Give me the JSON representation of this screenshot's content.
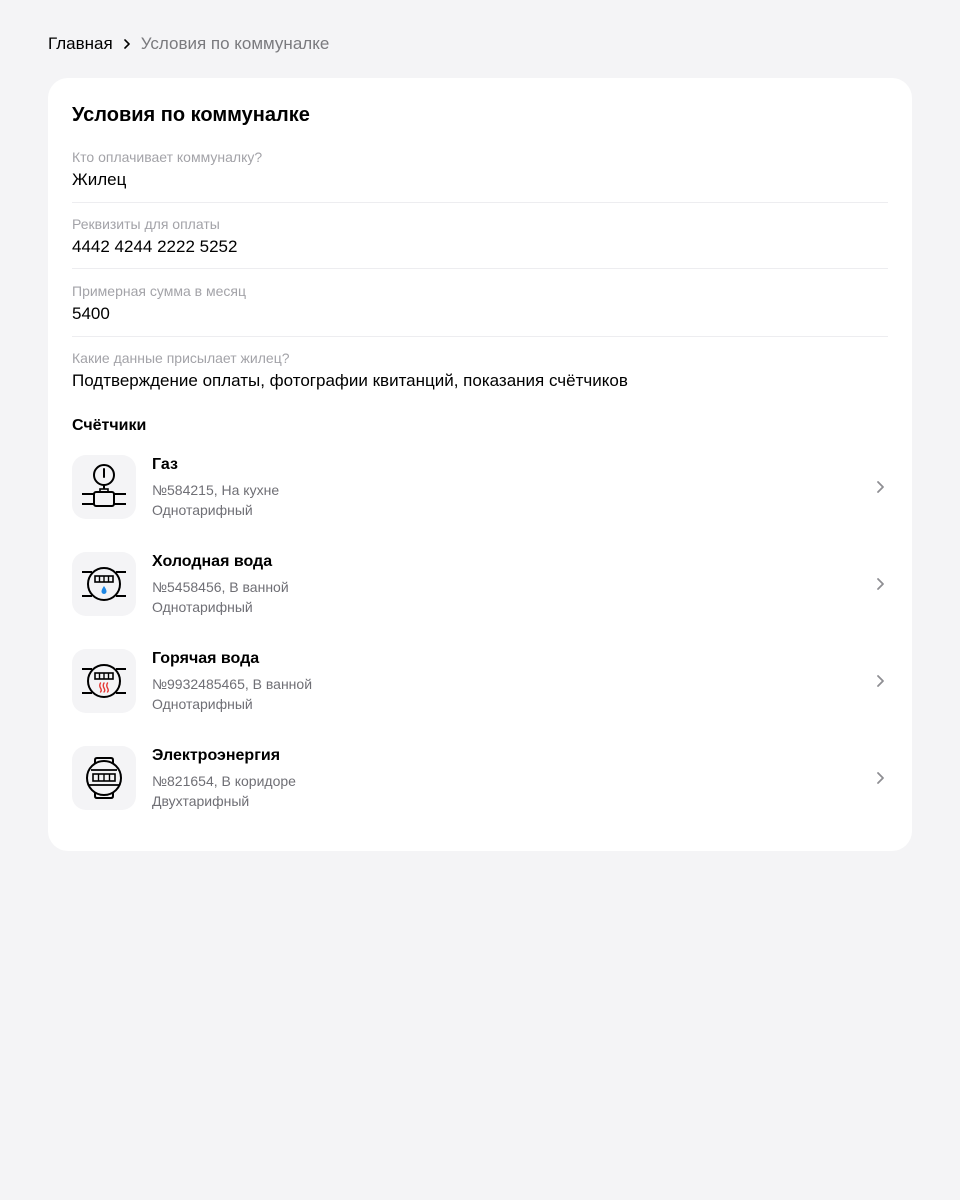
{
  "breadcrumb": {
    "home": "Главная",
    "current": "Условия по коммуналке"
  },
  "card": {
    "title": "Условия по коммуналке"
  },
  "fields": [
    {
      "label": "Кто оплачивает коммуналку?",
      "value": "Жилец"
    },
    {
      "label": "Реквизиты для оплаты",
      "value": "4442 4244 2222 5252"
    },
    {
      "label": "Примерная сумма в месяц",
      "value": "5400"
    },
    {
      "label": "Какие данные присылает жилец?",
      "value": "Подтверждение оплаты, фотографии квитанций, показания счётчиков"
    }
  ],
  "meters_section": {
    "title": "Счётчики",
    "items": [
      {
        "name": "Газ",
        "info": "№584215, На кухне",
        "tariff": "Однотарифный",
        "icon": "gas-meter-icon"
      },
      {
        "name": "Холодная вода",
        "info": "№5458456, В ванной",
        "tariff": "Однотарифный",
        "icon": "cold-water-meter-icon"
      },
      {
        "name": "Горячая вода",
        "info": "№9932485465, В ванной",
        "tariff": "Однотарифный",
        "icon": "hot-water-meter-icon"
      },
      {
        "name": "Электроэнергия",
        "info": "№821654, В коридоре",
        "tariff": "Двухтарифный",
        "icon": "electricity-meter-icon"
      }
    ]
  },
  "colors": {
    "background": "#f4f4f6",
    "card": "#ffffff",
    "label": "#a3a3a8",
    "secondary_text": "#6f6f75",
    "cold_water_drop": "#1e88e5",
    "hot_water_waves": "#e53935"
  }
}
